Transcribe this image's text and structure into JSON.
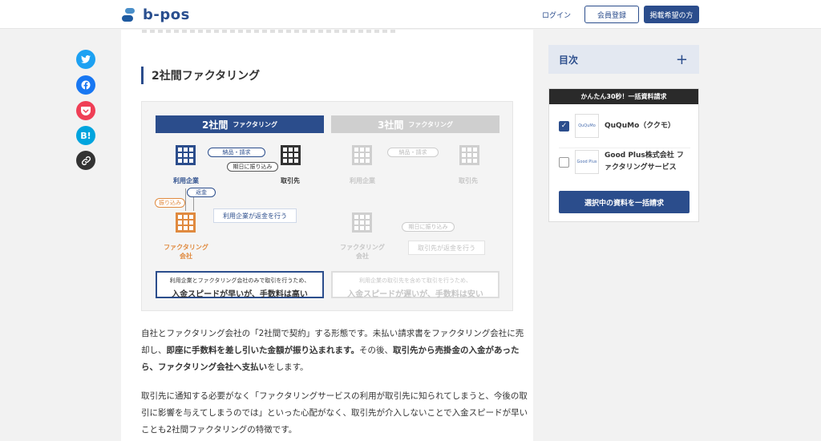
{
  "header": {
    "logo_text": "b-pos",
    "login": "ログイン",
    "register": "会員登録",
    "listing": "掲載希望の方"
  },
  "share": {
    "hatena": "B!"
  },
  "article": {
    "heading": "2社間ファクタリング",
    "figure": {
      "left": {
        "title": "2社間",
        "title_small": "ファクタリング",
        "user": "利用企業",
        "client": "取引先",
        "factor": "ファクタリング\n会社",
        "pill_delivery": "納品・請求",
        "pill_payment_date": "期日に振り込み",
        "pill_refund": "返金",
        "pill_transfer": "振り込み",
        "note": "利用企業が返金を行う",
        "foot_small": "利用企業とファクタリング会社のみで取引を行うため、",
        "foot_big": "入金スピードが早いが、手数料は高い"
      },
      "right": {
        "title": "3社間",
        "title_small": "ファクタリング",
        "user": "利用企業",
        "client": "取引先",
        "factor": "ファクタリング\n会社",
        "pill_delivery": "納品・請求",
        "pill_payment_date": "期日に振り込み",
        "note": "取引先が返金を行う",
        "foot_small": "利用企業の取引先を含めて取引を行うため、",
        "foot_big": "入金スピードが遅いが、手数料は安い"
      }
    },
    "para1": {
      "t1": "自社とファクタリング会社の「2社間で契約」する形態です。未払い請求書をファクタリング会社に売却し、",
      "b1": "即座に手数料を差し引いた金額が振り込まれます。",
      "t2": "その後、",
      "b2": "取引先から売掛金の入金があったら、ファクタリング会社へ支払い",
      "t3": "をします。"
    },
    "para2": "取引先に通知する必要がなく「ファクタリングサービスの利用が取引先に知られてしまうと、今後の取引に影響を与えてしまうのでは」といった心配がなく、取引先が介入しないことで入金スピードが早いことも2社間ファクタリングの特徴です。"
  },
  "sidebar": {
    "toc_title": "目次",
    "toc_plus": "+",
    "request_header": "かんたん30秒！一括資料請求",
    "items": [
      {
        "name": "QuQuMo（ククモ）",
        "checked": true,
        "thumb": "QuQuMo"
      },
      {
        "name": "Good Plus株式会社 ファクタリングサービス",
        "checked": false,
        "thumb": "Good Plus"
      }
    ],
    "submit": "選択中の資料を一括請求"
  },
  "colors": {
    "brand": "#2b4d8c",
    "orange": "#e08a3f",
    "twitter": "#1da1f2",
    "facebook": "#1877f2",
    "pocket": "#ef3f56",
    "hatena": "#00a4de"
  },
  "icons": [
    "twitter-icon",
    "facebook-icon",
    "pocket-icon",
    "hatena-icon",
    "link-icon",
    "building-icon",
    "check-icon",
    "plus-icon"
  ]
}
